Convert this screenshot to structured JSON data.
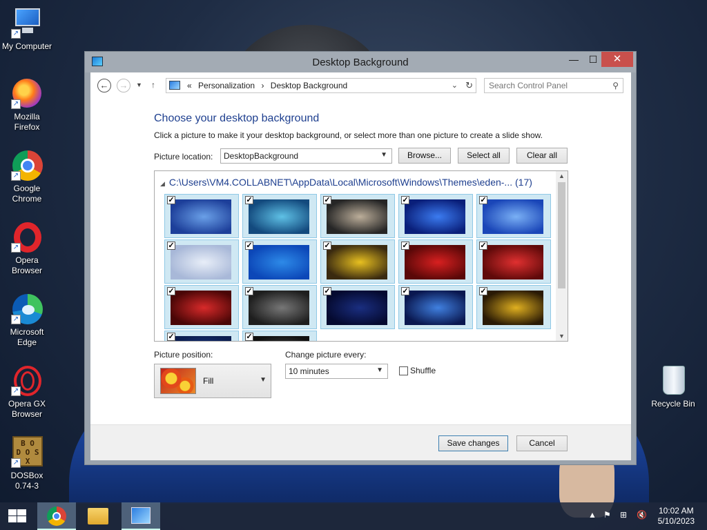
{
  "desktop": {
    "icons": [
      {
        "label": "My Computer",
        "icon": "computer-icon"
      },
      {
        "label": "Mozilla Firefox",
        "icon": "firefox-icon"
      },
      {
        "label": "Google Chrome",
        "icon": "chrome-icon"
      },
      {
        "label": "Opera Browser",
        "icon": "opera-icon"
      },
      {
        "label": "Microsoft Edge",
        "icon": "edge-icon"
      },
      {
        "label": "Opera GX Browser",
        "icon": "opera-gx-icon"
      },
      {
        "label": "DOSBox 0.74-3",
        "icon": "dosbox-icon"
      },
      {
        "label": "Recycle Bin",
        "icon": "recycle-bin-icon"
      }
    ]
  },
  "window": {
    "title": "Desktop Background",
    "close_glyph": "✕",
    "maximize_glyph": "☐",
    "minimize_glyph": "—"
  },
  "address": {
    "prefix": "«",
    "crumbs": [
      "Personalization",
      "Desktop Background"
    ],
    "separator": "›",
    "search_placeholder": "Search Control Panel"
  },
  "content": {
    "heading": "Choose your desktop background",
    "subtext": "Click a picture to make it your desktop background, or select more than one picture to create a slide show.",
    "picture_location_label": "Picture location:",
    "picture_location_value": "DesktopBackground",
    "browse_label": "Browse...",
    "select_all_label": "Select all",
    "clear_all_label": "Clear all",
    "folder_path": "C:\\Users\\VM4.COLLABNET\\AppData\\Local\\Microsoft\\Windows\\Themes\\eden-...",
    "folder_count": "(17)",
    "picture_position_label": "Picture position:",
    "picture_position_value": "Fill",
    "change_every_label": "Change picture every:",
    "change_every_value": "10 minutes",
    "shuffle_label": "Shuffle",
    "shuffle_checked": false,
    "save_label": "Save changes",
    "cancel_label": "Cancel"
  },
  "gallery": {
    "checkmark": "✓",
    "tiles": [
      {
        "checked": true,
        "c1": "#1d3f9a",
        "c2": "#6aa0e8"
      },
      {
        "checked": true,
        "c1": "#134a7e",
        "c2": "#5fc1e6"
      },
      {
        "checked": true,
        "c1": "#262626",
        "c2": "#bcae9a"
      },
      {
        "checked": true,
        "c1": "#0a1f7a",
        "c2": "#3b7bf0"
      },
      {
        "checked": true,
        "c1": "#1a46b8",
        "c2": "#7ab0f5"
      },
      {
        "checked": true,
        "c1": "#a8b8d8",
        "c2": "#e8eef8"
      },
      {
        "checked": true,
        "c1": "#0c47b8",
        "c2": "#2d8ae8"
      },
      {
        "checked": true,
        "c1": "#3a2a10",
        "c2": "#e8c020"
      },
      {
        "checked": true,
        "c1": "#5a0808",
        "c2": "#d82020"
      },
      {
        "checked": true,
        "c1": "#600a0a",
        "c2": "#e03030"
      },
      {
        "checked": true,
        "c1": "#4a0606",
        "c2": "#d82a2a"
      },
      {
        "checked": true,
        "c1": "#1e1e1e",
        "c2": "#777777"
      },
      {
        "checked": true,
        "c1": "#050a30",
        "c2": "#1a2e80"
      },
      {
        "checked": true,
        "c1": "#0a1850",
        "c2": "#4080e0"
      },
      {
        "checked": true,
        "c1": "#2a1a05",
        "c2": "#e0b020"
      },
      {
        "checked": true,
        "c1": "#0c1e50",
        "c2": "#203e90"
      },
      {
        "checked": true,
        "c1": "#101010",
        "c2": "#505050"
      }
    ]
  },
  "taskbar": {
    "start_icon": "windows-start-icon",
    "items": [
      {
        "icon": "chrome-taskbar-icon",
        "active": true
      },
      {
        "icon": "file-explorer-icon",
        "active": false
      },
      {
        "icon": "control-panel-icon",
        "active": true
      }
    ],
    "time": "10:02 AM",
    "date": "5/10/2023"
  }
}
